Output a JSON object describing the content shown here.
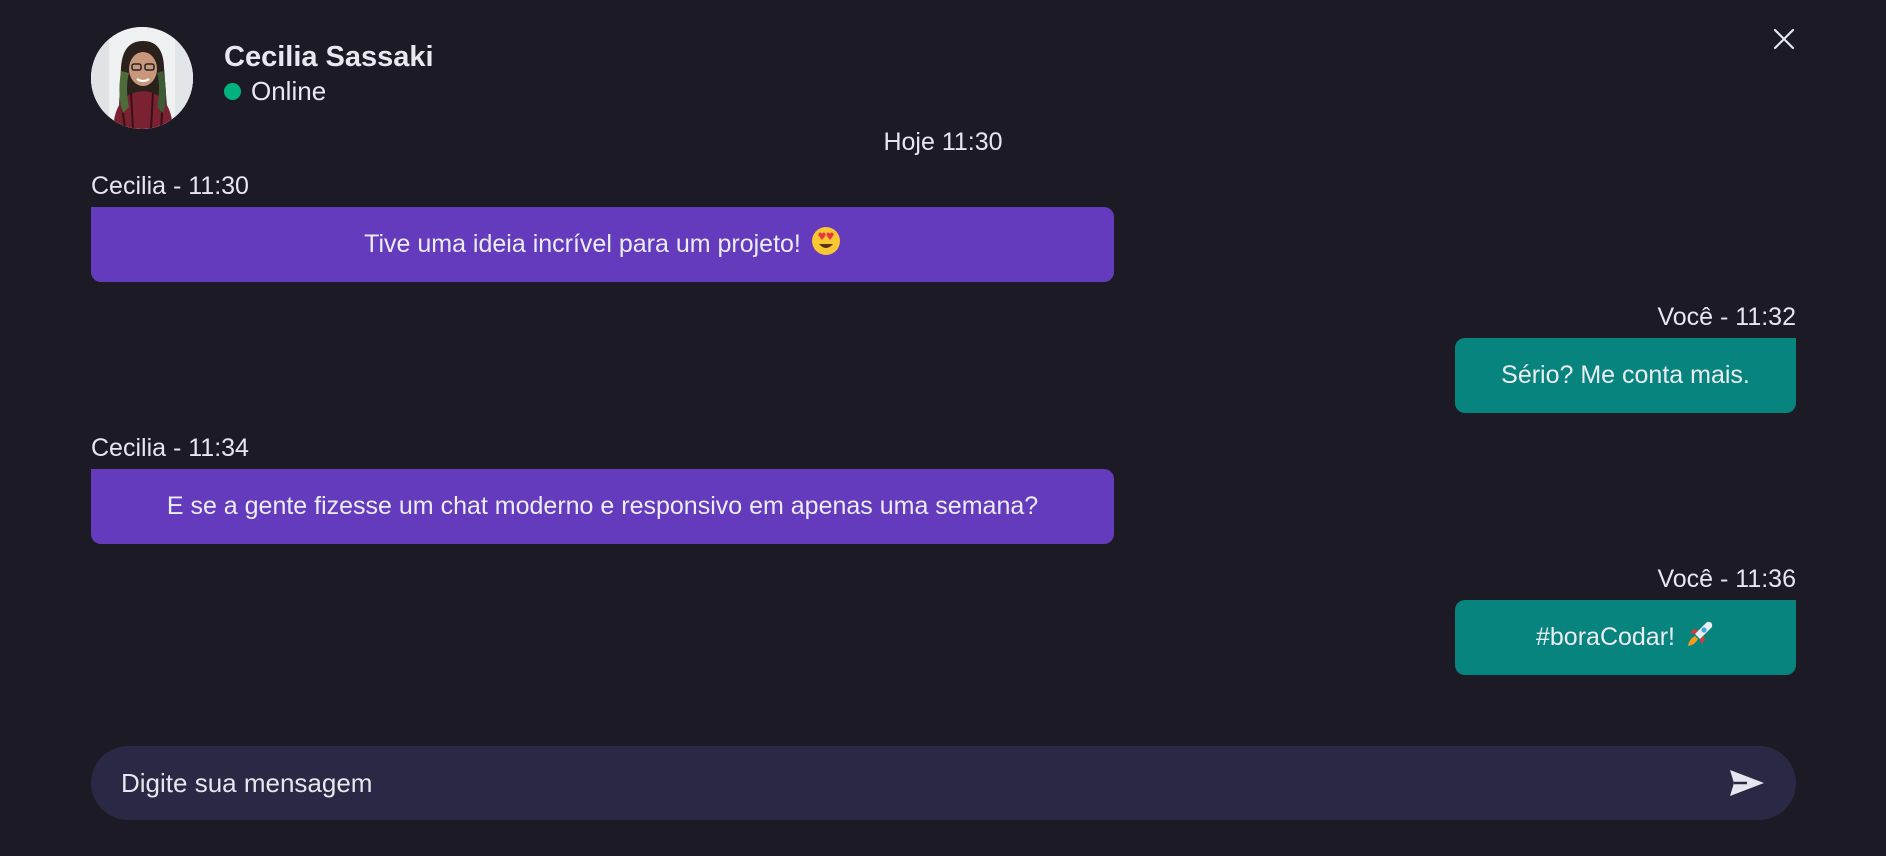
{
  "contact": {
    "name": "Cecilia Sassaki",
    "status": "Online",
    "status_color": "#00b37e"
  },
  "icons": {
    "close": "close-icon",
    "send": "send-icon",
    "avatar": "avatar-photo"
  },
  "chat": {
    "date_label": "Hoje 11:30",
    "messages": [
      {
        "direction": "incoming",
        "meta": "Cecilia - 11:30",
        "text": "Tive uma ideia incrível para um projeto!",
        "emoji": "heart-eyes-emoji"
      },
      {
        "direction": "outgoing",
        "meta": "Você - 11:32",
        "text": "Sério? Me conta mais."
      },
      {
        "direction": "incoming",
        "meta": "Cecilia - 11:34",
        "text": "E se a gente fizesse um chat moderno e responsivo em apenas uma semana?"
      },
      {
        "direction": "outgoing",
        "meta": "Você - 11:36",
        "text": "#boraCodar!",
        "emoji": "rocket-emoji"
      }
    ]
  },
  "composer": {
    "placeholder": "Digite sua mensagem",
    "value": ""
  },
  "colors": {
    "background": "#1c1b25",
    "incoming_bubble": "#633bbc",
    "outgoing_bubble": "#07847e",
    "composer_bg": "#292845"
  }
}
